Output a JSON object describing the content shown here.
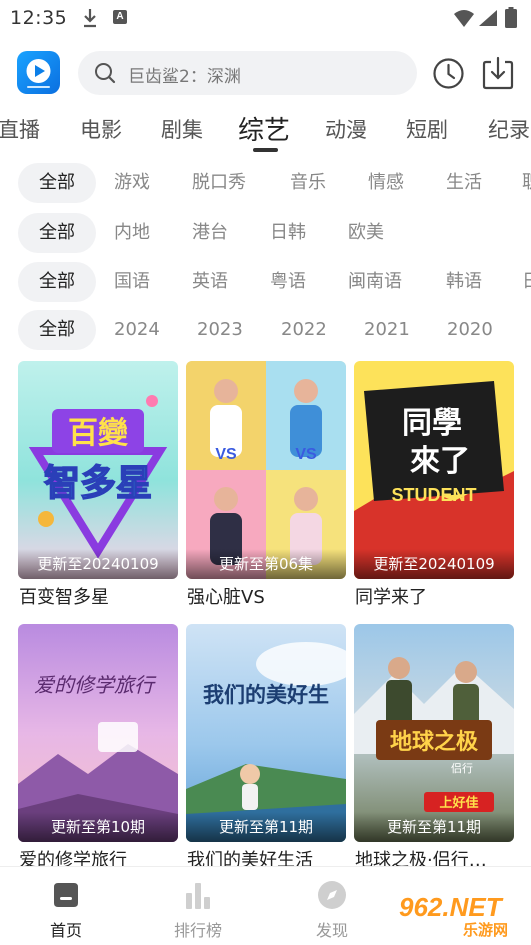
{
  "status_bar": {
    "time": "12:35",
    "badge": "A"
  },
  "header": {
    "search_placeholder": "巨齿鲨2：深渊",
    "logo_icon": "video-play-app-logo",
    "history_icon": "clock-icon",
    "download_icon": "download-icon"
  },
  "channel_tabs": [
    "直播",
    "电影",
    "剧集",
    "综艺",
    "动漫",
    "短剧",
    "纪录"
  ],
  "active_channel": "综艺",
  "filters": {
    "genre": [
      "全部",
      "游戏",
      "脱口秀",
      "音乐",
      "情感",
      "生活",
      "职"
    ],
    "region": [
      "全部",
      "内地",
      "港台",
      "日韩",
      "欧美"
    ],
    "language": [
      "全部",
      "国语",
      "英语",
      "粤语",
      "闽南语",
      "韩语",
      "日"
    ],
    "year": [
      "全部",
      "2024",
      "2023",
      "2022",
      "2021",
      "2020"
    ]
  },
  "cards": [
    {
      "title": "百变智多星",
      "update": "更新至20240109",
      "poster_text": [
        "百變",
        "智多星"
      ]
    },
    {
      "title": "强心脏VS",
      "update": "更新至第06集",
      "poster_text": [
        "VS",
        "VS"
      ]
    },
    {
      "title": "同学来了",
      "update": "更新至20240109",
      "poster_text": [
        "同學",
        "來了",
        "STUDENT"
      ]
    },
    {
      "title": "爱的修学旅行",
      "update": "更新至第10期",
      "poster_text": [
        "爱的修学旅行"
      ]
    },
    {
      "title": "我们的美好生活",
      "update": "更新至第11期",
      "poster_text": [
        "我们的美好生"
      ]
    },
    {
      "title": "地球之极·侣行…",
      "update": "更新至第11期",
      "poster_text": [
        "地球之极",
        "侣行",
        "上好佳"
      ]
    }
  ],
  "bottom_nav": [
    {
      "label": "首页",
      "icon": "home-icon"
    },
    {
      "label": "排行榜",
      "icon": "bar-chart-icon"
    },
    {
      "label": "发现",
      "icon": "compass-icon"
    }
  ],
  "watermark": {
    "main": "962.NET",
    "sub": "乐游网"
  },
  "colors": {
    "accent": "#1aa3ff",
    "chip_bg": "#f1f2f4",
    "watermark": "#ff9a1e"
  }
}
